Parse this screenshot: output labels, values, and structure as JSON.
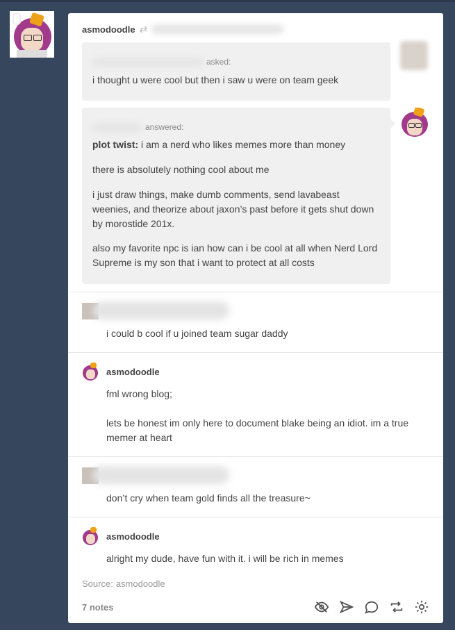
{
  "post": {
    "username": "asmodoodle",
    "ask": {
      "meta": "asked:",
      "text": "i thought u were cool but then i saw u were on team geek"
    },
    "answer": {
      "meta": "answered:",
      "bold_lead": "plot twist:",
      "lead_rest": " i am a nerd who likes memes more than money",
      "paragraphs": [
        "there is absolutely nothing cool about me",
        "i just draw things, make dumb comments, send lavabeast weenies, and theorize about jaxon’s past before it gets shut down by morostide 201x.",
        "also my favorite npc is ian how can i be cool at all when Nerd Lord Supreme is my son that i want to protect at all costs"
      ]
    }
  },
  "replies": [
    {
      "name": "",
      "text": "i could b cool if u joined team sugar daddy"
    },
    {
      "name": "asmodoodle",
      "text1": "fml wrong blog;",
      "text2": "lets be honest im only here to document blake being an idiot. im a true memer at heart"
    },
    {
      "name": "",
      "text": "don’t cry when team gold finds all the treasure~"
    },
    {
      "name": "asmodoodle",
      "text": "alright my dude, have fun with it. i will be rich in memes"
    }
  ],
  "footer": {
    "source_label": "Source:",
    "source_name": "asmodoodle",
    "notes": "7 notes",
    "icons": [
      "eye-off-icon",
      "send-icon",
      "reply-icon",
      "reblog-icon",
      "gear-icon"
    ]
  },
  "colors": {
    "dashboard_bg": "#36465d",
    "card_bg": "#ffffff",
    "bubble_bg": "#f0f0f0"
  }
}
